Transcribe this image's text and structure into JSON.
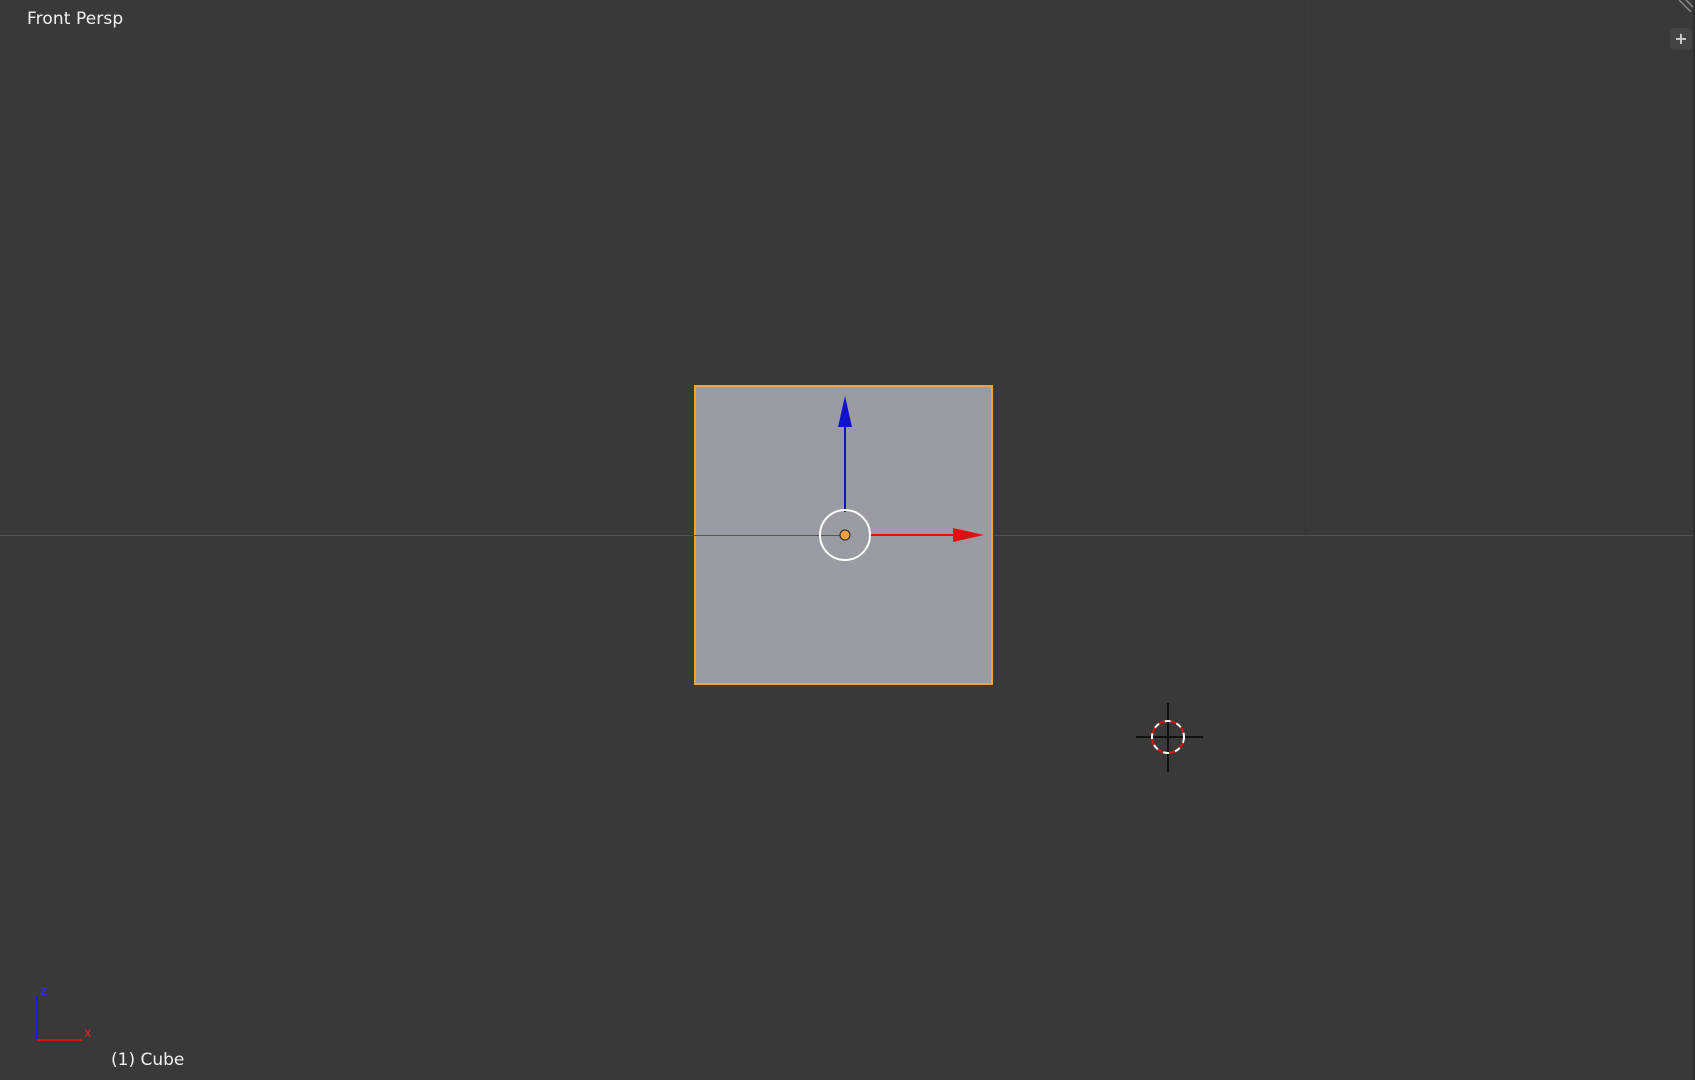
{
  "viewport": {
    "view_label": "Front Persp",
    "active_object_label": "(1) Cube"
  },
  "axis_gizmo": {
    "z_label": "z",
    "x_label": "x"
  },
  "colors": {
    "background": "#393939",
    "cube_face": "#9b9ba3",
    "selection_outline": "#f3a33a",
    "x_axis": "#dd1111",
    "z_axis": "#1111cc",
    "text": "#f0f0f0"
  },
  "icons": {
    "add_region": "plus-icon",
    "cursor": "3d-cursor-icon",
    "origin": "object-origin-icon"
  }
}
